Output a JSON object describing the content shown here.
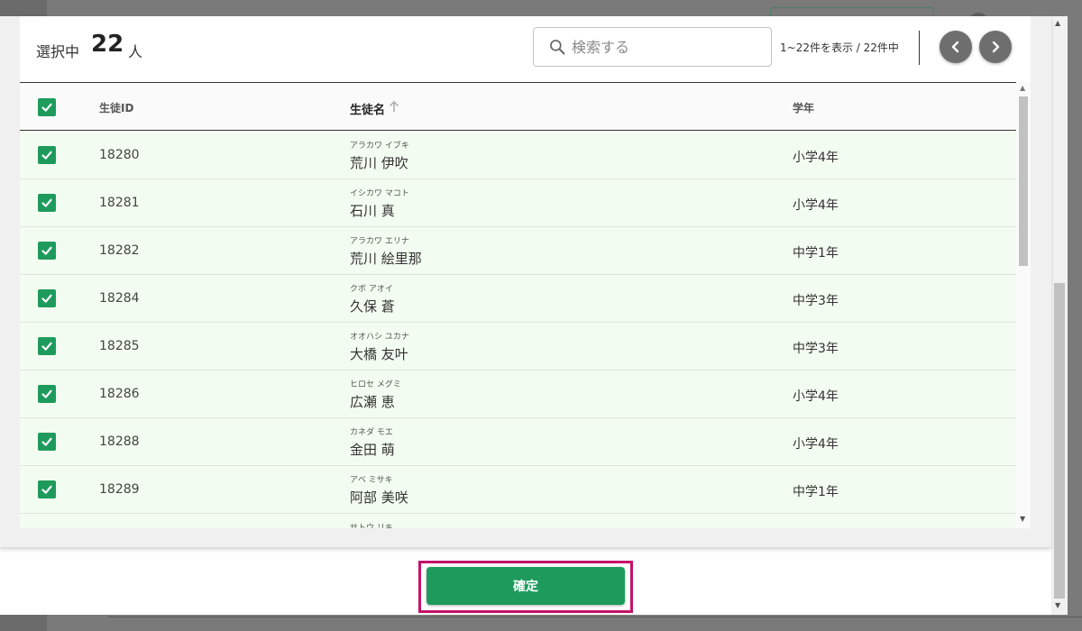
{
  "header": {
    "selected_label": "選択中",
    "selected_count": "22",
    "selected_unit": "人",
    "search_placeholder": "検索する",
    "range_text": "1~22件を表示 / 22件中"
  },
  "table": {
    "columns": {
      "id": "生徒ID",
      "name": "生徒名",
      "grade": "学年"
    },
    "rows": [
      {
        "id": "18280",
        "kana": "アラカワ イブキ",
        "name": "荒川 伊吹",
        "grade": "小学4年"
      },
      {
        "id": "18281",
        "kana": "イシカワ マコト",
        "name": "石川 真",
        "grade": "小学4年"
      },
      {
        "id": "18282",
        "kana": "アラカワ エリナ",
        "name": "荒川 絵里那",
        "grade": "中学1年"
      },
      {
        "id": "18284",
        "kana": "クボ アオイ",
        "name": "久保 蒼",
        "grade": "中学3年"
      },
      {
        "id": "18285",
        "kana": "オオハシ ユカナ",
        "name": "大橋 友叶",
        "grade": "中学3年"
      },
      {
        "id": "18286",
        "kana": "ヒロセ メグミ",
        "name": "広瀬 恵",
        "grade": "小学4年"
      },
      {
        "id": "18288",
        "kana": "カネダ モエ",
        "name": "金田 萌",
        "grade": "小学4年"
      },
      {
        "id": "18289",
        "kana": "アベ ミサキ",
        "name": "阿部 美咲",
        "grade": "中学1年"
      },
      {
        "id": "",
        "kana": "サトウ リキ",
        "name": "",
        "grade": ""
      }
    ]
  },
  "footer": {
    "confirm_label": "確定"
  },
  "colors": {
    "accent_green": "#1e9b5c",
    "row_highlight": "#f3fcf0",
    "callout_border": "#c4126a"
  },
  "icons": {
    "search": "search-icon",
    "prev": "chevron-left-icon",
    "next": "chevron-right-icon",
    "sort": "arrow-up-icon",
    "checkbox": "checkbox-checked-icon"
  }
}
